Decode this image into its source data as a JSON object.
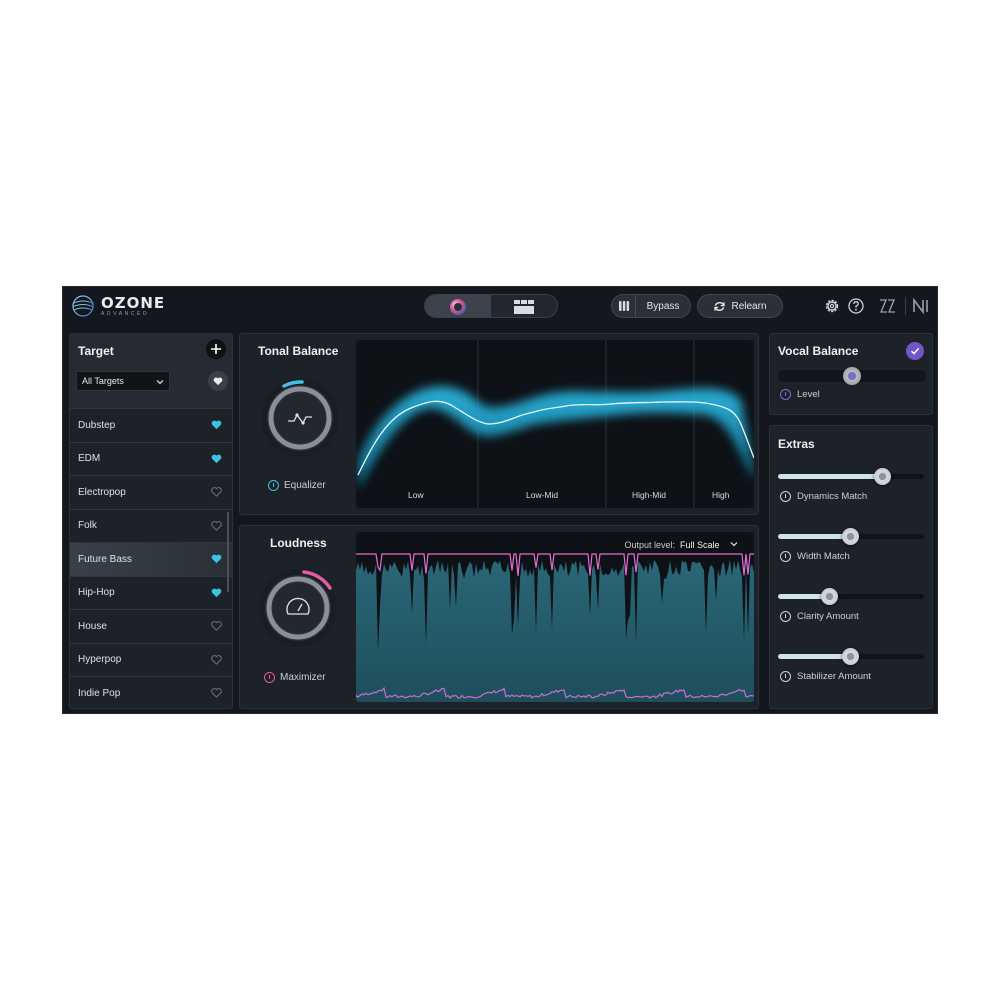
{
  "app": {
    "logo": {
      "name": "OZONE",
      "edition": "ADVANCED"
    },
    "bypass_label": "Bypass",
    "relearn_label": "Relearn"
  },
  "target": {
    "title": "Target",
    "filter_value": "All Targets",
    "items": [
      {
        "label": "Dubstep",
        "favorite": true
      },
      {
        "label": "EDM",
        "favorite": true
      },
      {
        "label": "Electropop",
        "favorite": false
      },
      {
        "label": "Folk",
        "favorite": false
      },
      {
        "label": "Future Bass",
        "favorite": true,
        "selected": true
      },
      {
        "label": "Hip-Hop",
        "favorite": true
      },
      {
        "label": "House",
        "favorite": false
      },
      {
        "label": "Hyperpop",
        "favorite": false
      },
      {
        "label": "Indie Pop",
        "favorite": false
      }
    ]
  },
  "tonal_balance": {
    "title": "Tonal Balance",
    "module_label": "Equalizer",
    "bands": [
      "Low",
      "Low-Mid",
      "High-Mid",
      "High"
    ]
  },
  "loudness": {
    "title": "Loudness",
    "module_label": "Maximizer",
    "output_level_label": "Output level:",
    "output_level_value": "Full Scale"
  },
  "vocal_balance": {
    "title": "Vocal Balance",
    "level_label": "Level",
    "level_value": 0.5
  },
  "extras": {
    "title": "Extras",
    "sliders": [
      {
        "label": "Dynamics Match",
        "value": 0.71
      },
      {
        "label": "Width Match",
        "value": 0.49
      },
      {
        "label": "Clarity Amount",
        "value": 0.35
      },
      {
        "label": "Stabilizer Amount",
        "value": 0.49
      }
    ]
  },
  "colors": {
    "accent_cyan": "#3fc1e6",
    "accent_pink": "#e65aa8",
    "accent_purple": "#7257c9"
  }
}
